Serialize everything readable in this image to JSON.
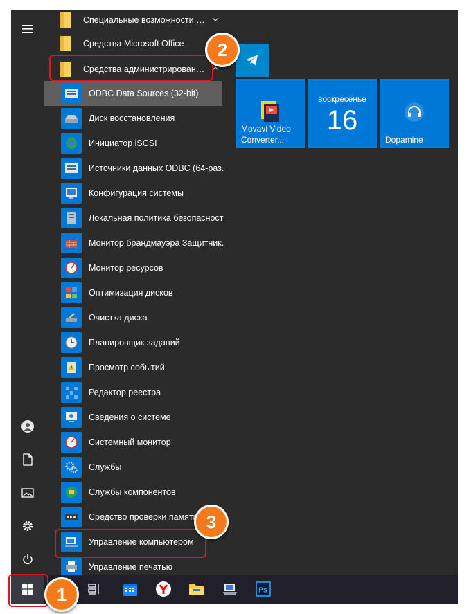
{
  "folders": [
    {
      "label": "Специальные возможности Wi...",
      "chevron": true
    },
    {
      "label": "Средства Microsoft Office",
      "chevron": false
    },
    {
      "label": "Средства администрирования...",
      "chevron": true
    }
  ],
  "apps": [
    {
      "label": "ODBC Data Sources (32-bit)",
      "icon": "odbc-icon"
    },
    {
      "label": "Диск восстановления",
      "icon": "drive-icon"
    },
    {
      "label": "Инициатор iSCSI",
      "icon": "globe-icon"
    },
    {
      "label": "Источники данных ODBC (64-раз...",
      "icon": "odbc-icon"
    },
    {
      "label": "Конфигурация системы",
      "icon": "config-icon"
    },
    {
      "label": "Локальная политика безопасности",
      "icon": "policy-icon"
    },
    {
      "label": "Монитор брандмауэра Защитник...",
      "icon": "firewall-icon"
    },
    {
      "label": "Монитор ресурсов",
      "icon": "gauge-icon"
    },
    {
      "label": "Оптимизация дисков",
      "icon": "defrag-icon"
    },
    {
      "label": "Очистка диска",
      "icon": "cleanup-icon"
    },
    {
      "label": "Планировщик заданий",
      "icon": "clock-icon"
    },
    {
      "label": "Просмотр событий",
      "icon": "event-icon"
    },
    {
      "label": "Редактор реестра",
      "icon": "registry-icon"
    },
    {
      "label": "Сведения о системе",
      "icon": "sysinfo-icon"
    },
    {
      "label": "Системный монитор",
      "icon": "gauge-icon"
    },
    {
      "label": "Службы",
      "icon": "gear-icon"
    },
    {
      "label": "Службы компонентов",
      "icon": "components-icon"
    },
    {
      "label": "Средство проверки памяти",
      "icon": "memory-icon"
    },
    {
      "label": "Управление компьютером",
      "icon": "computer-mgmt-icon"
    },
    {
      "label": "Управление печатью",
      "icon": "print-icon"
    }
  ],
  "tiles": {
    "movavi": "Movavi Video Converter...",
    "calendar_day": "воскресенье",
    "calendar_date": "16",
    "dopamine": "Dopamine"
  },
  "badges": [
    "1",
    "2",
    "3"
  ],
  "colors": {
    "accent": "#0078d7",
    "callout": "#e0141e",
    "badge": "#f57a1c"
  }
}
